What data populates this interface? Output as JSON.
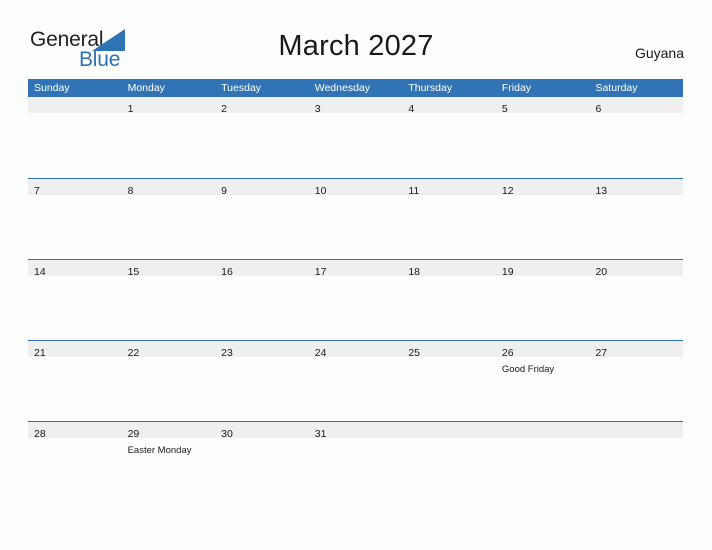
{
  "brand": {
    "name_part1": "General",
    "name_part2": "Blue",
    "flag_icon": "triangle-flag-icon",
    "accent_color": "#2E74B5"
  },
  "header": {
    "title": "March 2027",
    "country": "Guyana"
  },
  "calendar": {
    "month": "March",
    "year": "2027",
    "header_bg": "#3174B5",
    "band_bg": "#EFEFEF",
    "rule_color": "#2E74B5",
    "weekdays": [
      "Sunday",
      "Monday",
      "Tuesday",
      "Wednesday",
      "Thursday",
      "Friday",
      "Saturday"
    ],
    "weeks": [
      [
        {
          "day": ""
        },
        {
          "day": "1"
        },
        {
          "day": "2"
        },
        {
          "day": "3"
        },
        {
          "day": "4"
        },
        {
          "day": "5"
        },
        {
          "day": "6"
        }
      ],
      [
        {
          "day": "7"
        },
        {
          "day": "8"
        },
        {
          "day": "9"
        },
        {
          "day": "10"
        },
        {
          "day": "11"
        },
        {
          "day": "12"
        },
        {
          "day": "13"
        }
      ],
      [
        {
          "day": "14"
        },
        {
          "day": "15"
        },
        {
          "day": "16"
        },
        {
          "day": "17"
        },
        {
          "day": "18"
        },
        {
          "day": "19"
        },
        {
          "day": "20"
        }
      ],
      [
        {
          "day": "21"
        },
        {
          "day": "22"
        },
        {
          "day": "23"
        },
        {
          "day": "24"
        },
        {
          "day": "25"
        },
        {
          "day": "26",
          "event": "Good Friday"
        },
        {
          "day": "27"
        }
      ],
      [
        {
          "day": "28"
        },
        {
          "day": "29",
          "event": "Easter Monday"
        },
        {
          "day": "30"
        },
        {
          "day": "31"
        },
        {
          "day": ""
        },
        {
          "day": ""
        },
        {
          "day": ""
        }
      ]
    ]
  }
}
